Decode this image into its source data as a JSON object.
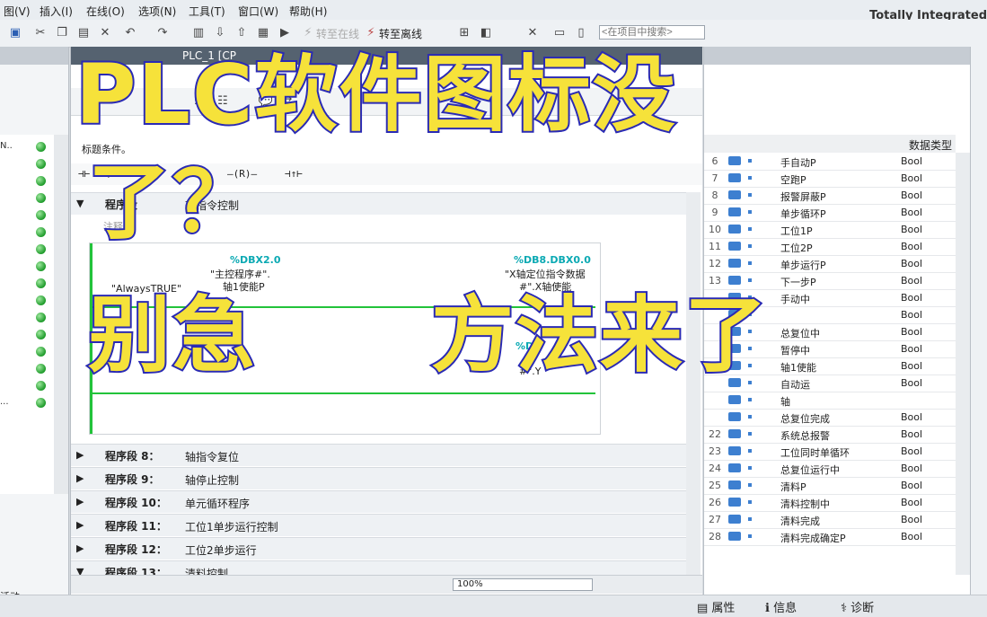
{
  "menu": {
    "items": [
      "图(V)",
      "插入(I)",
      "在线(O)",
      "选项(N)",
      "工具(T)",
      "窗口(W)",
      "帮助(H)"
    ],
    "app_title": "Totally Integrated"
  },
  "toolbar": {
    "go_online": "转至在线",
    "go_offline": "转至离线",
    "search_placeholder": "<在项目中搜索>"
  },
  "editor": {
    "tab_title": "PLC_1 [CP",
    "block_condition": "标题条件。",
    "ladder_symbols": [
      "⊣⊢",
      "⊣/⊢",
      "—( )—",
      "—(R)—",
      "⊣↑⊢"
    ],
    "network7": {
      "label": "程序段",
      "desc": "轴指令控制",
      "comment": "注释",
      "contact_left_sym": "\"AlwaysTRUE\"",
      "coil1_addr": "%DBX2.0",
      "coil1_sym1": "\"主控程序#\".",
      "coil1_sym2": "轴1使能P",
      "coil2_addr": "%DB8.DBX0.0",
      "coil2_sym1": "\"X轴定位指令数据",
      "coil2_sym2": "#\".X轴使能",
      "coil3_addr": "%DB",
      "coil3_sym": "#\".Y"
    },
    "networks": [
      {
        "label": "程序段 8：",
        "desc": "轴指令复位"
      },
      {
        "label": "程序段 9：",
        "desc": "轴停止控制"
      },
      {
        "label": "程序段 10：",
        "desc": "单元循环程序"
      },
      {
        "label": "程序段 11：",
        "desc": "工位1单步运行控制"
      },
      {
        "label": "程序段 12：",
        "desc": "工位2单步运行"
      },
      {
        "label": "程序段 13：",
        "desc": "清料控制"
      }
    ],
    "zoom": "100%"
  },
  "tags": {
    "header_type": "数据类型",
    "rows": [
      {
        "n": "6",
        "name": "手自动P",
        "type": "Bool"
      },
      {
        "n": "7",
        "name": "空跑P",
        "type": "Bool"
      },
      {
        "n": "8",
        "name": "报警屏蔽P",
        "type": "Bool"
      },
      {
        "n": "9",
        "name": "单步循环P",
        "type": "Bool"
      },
      {
        "n": "10",
        "name": "工位1P",
        "type": "Bool"
      },
      {
        "n": "11",
        "name": "工位2P",
        "type": "Bool"
      },
      {
        "n": "12",
        "name": "单步运行P",
        "type": "Bool"
      },
      {
        "n": "13",
        "name": "下一步P",
        "type": "Bool"
      },
      {
        "n": "",
        "name": "手动中",
        "type": "Bool"
      },
      {
        "n": "",
        "name": "",
        "type": "Bool"
      },
      {
        "n": "",
        "name": "总复位中",
        "type": "Bool"
      },
      {
        "n": "",
        "name": "暂停中",
        "type": "Bool"
      },
      {
        "n": "",
        "name": "轴1使能",
        "type": "Bool"
      },
      {
        "n": "",
        "name": "自动运",
        "type": "Bool"
      },
      {
        "n": "",
        "name": "轴",
        "type": ""
      },
      {
        "n": "",
        "name": "总复位完成",
        "type": "Bool"
      },
      {
        "n": "22",
        "name": "系统总报警",
        "type": "Bool"
      },
      {
        "n": "23",
        "name": "工位同时单循环",
        "type": "Bool"
      },
      {
        "n": "24",
        "name": "总复位运行中",
        "type": "Bool"
      },
      {
        "n": "25",
        "name": "清料P",
        "type": "Bool"
      },
      {
        "n": "26",
        "name": "清料控制中",
        "type": "Bool"
      },
      {
        "n": "27",
        "name": "清料完成",
        "type": "Bool"
      },
      {
        "n": "28",
        "name": "清料完成确定P",
        "type": "Bool"
      }
    ]
  },
  "left": {
    "rows": [
      "N..",
      "",
      "",
      "",
      "",
      "",
      "",
      "",
      "",
      "",
      "",
      "",
      "",
      "",
      "",
      "..."
    ],
    "bottom_label": "活动"
  },
  "status": {
    "properties": "属性",
    "info": "信息",
    "diagnostics": "诊断"
  },
  "overlay": {
    "line1": "PLC软件图标没",
    "line2": "了？",
    "line3a": "别急",
    "line3b": "方法来了"
  },
  "colors": {
    "overlay_fill": "#f6e23a",
    "overlay_stroke": "#2a2ab4",
    "status_ok": "#1e9b2a",
    "operand_addr": "#0aa9b3"
  }
}
